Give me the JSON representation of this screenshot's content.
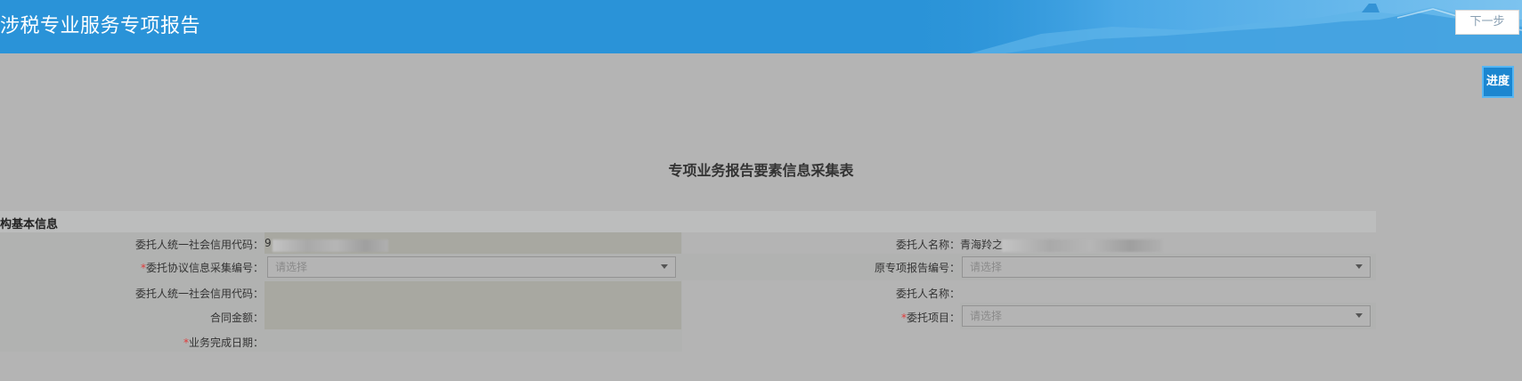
{
  "header": {
    "title": "涉税专业服务专项报告",
    "next_label": "下一步"
  },
  "progress_label": "进度",
  "form": {
    "title": "专项业务报告要素信息采集表",
    "section_title": "构基本信息",
    "fields": {
      "client_credit_code": {
        "label": "委托人统一社会信用代码：",
        "value": "9"
      },
      "client_name": {
        "label": "委托人名称：",
        "value": "青海羚之"
      },
      "agreement_no": {
        "label": "委托协议信息采集编号：",
        "placeholder": "请选择"
      },
      "original_report_no": {
        "label": "原专项报告编号：",
        "placeholder": "请选择"
      },
      "client_credit_code_2": {
        "label": "委托人统一社会信用代码："
      },
      "client_name_2": {
        "label": "委托人名称："
      },
      "contract_amount": {
        "label": "合同金额："
      },
      "entrusted_item": {
        "label": "委托项目：",
        "placeholder": "请选择"
      },
      "completion_date": {
        "label": "业务完成日期："
      }
    },
    "required_mark": "*"
  },
  "colors": {
    "header_blue": "#2a93d8",
    "progress_blue": "#1b86d0",
    "required_red": "#e03c3c"
  }
}
